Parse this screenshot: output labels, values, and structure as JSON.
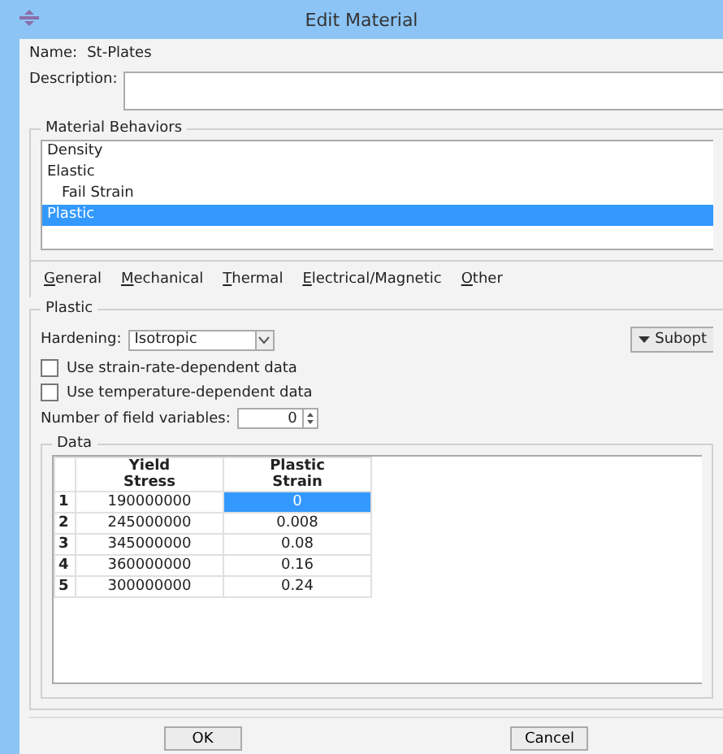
{
  "window": {
    "title": "Edit Material"
  },
  "name": {
    "label": "Name:",
    "value": "St-Plates"
  },
  "description": {
    "label": "Description:"
  },
  "behaviors": {
    "title": "Material Behaviors",
    "items": [
      {
        "label": "Density",
        "selected": false
      },
      {
        "label": "Elastic",
        "selected": false,
        "children": [
          {
            "label": "Fail Strain",
            "selected": false
          }
        ]
      },
      {
        "label": "Plastic",
        "selected": true
      }
    ]
  },
  "menu": [
    {
      "label": "General"
    },
    {
      "label": "Mechanical"
    },
    {
      "label": "Thermal"
    },
    {
      "label": "Electrical/Magnetic"
    },
    {
      "label": "Other"
    }
  ],
  "plastic": {
    "title": "Plastic",
    "hardening_label": "Hardening:",
    "hardening_value": "Isotropic",
    "suboptions": "Subopt",
    "checkboxes": [
      {
        "label": "Use strain-rate-dependent data",
        "checked": false
      },
      {
        "label": "Use temperature-dependent data",
        "checked": false
      }
    ],
    "field_variables_label": "Number of field variables:",
    "field_variables_value": "0",
    "data": {
      "title": "Data",
      "columns": [
        "Yield\nStress",
        "Plastic\nStrain"
      ],
      "rows": [
        {
          "number": "1",
          "cells": [
            {
              "text": "190000000",
              "selected": false
            },
            {
              "text": "0",
              "selected": true
            }
          ]
        },
        {
          "number": "2",
          "cells": [
            {
              "text": "245000000",
              "selected": false
            },
            {
              "text": "0.008",
              "selected": false
            }
          ]
        },
        {
          "number": "3",
          "cells": [
            {
              "text": "345000000",
              "selected": false
            },
            {
              "text": "0.08",
              "selected": false
            }
          ]
        },
        {
          "number": "4",
          "cells": [
            {
              "text": "360000000",
              "selected": false
            },
            {
              "text": "0.16",
              "selected": false
            }
          ]
        },
        {
          "number": "5",
          "cells": [
            {
              "text": "300000000",
              "selected": false
            },
            {
              "text": "0.24",
              "selected": false
            }
          ]
        }
      ]
    }
  },
  "buttons": [
    "OK",
    "Cancel"
  ]
}
